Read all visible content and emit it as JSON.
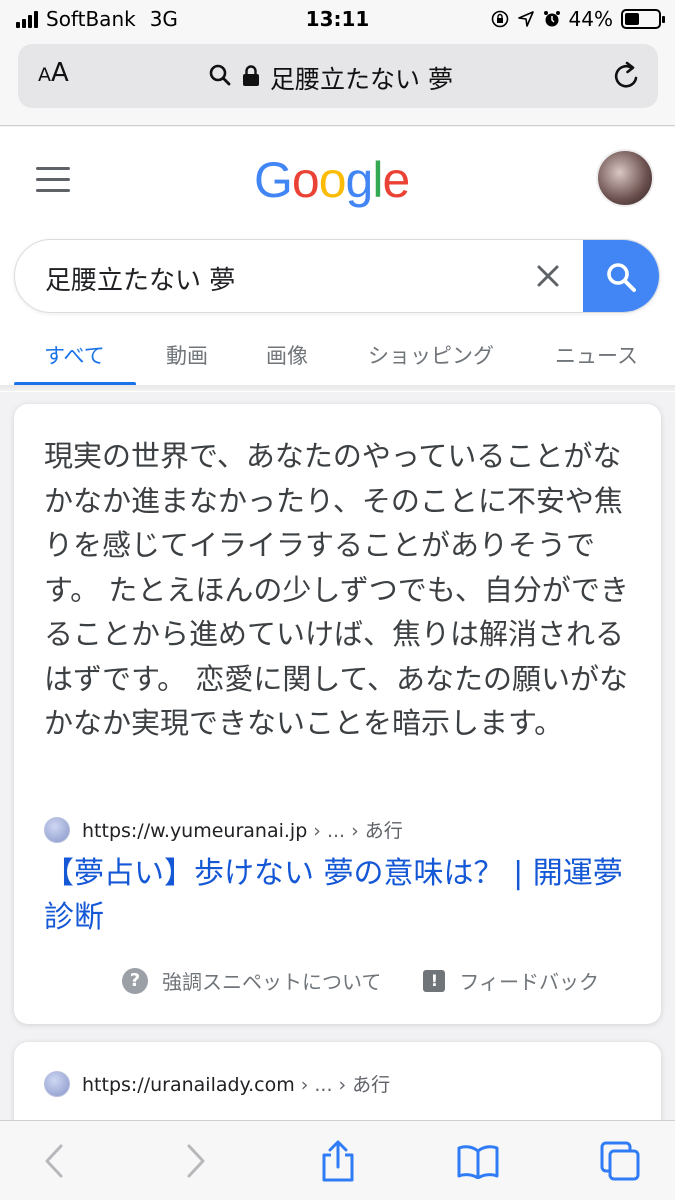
{
  "status_bar": {
    "carrier": "SoftBank",
    "network": "3G",
    "time": "13:11",
    "battery": "44%",
    "battery_level": 0.44
  },
  "safari": {
    "text_size_label": "AA",
    "address": "足腰立たない 夢"
  },
  "google": {
    "logo": "Google",
    "logo_colors": [
      "#4285f4",
      "#ea4335",
      "#fbbc05",
      "#4285f4",
      "#34a853",
      "#ea4335"
    ],
    "search_query": "足腰立たない 夢",
    "tabs": [
      {
        "label": "すべて",
        "active": true
      },
      {
        "label": "動画",
        "active": false
      },
      {
        "label": "画像",
        "active": false
      },
      {
        "label": "ショッピング",
        "active": false
      },
      {
        "label": "ニュース",
        "active": false
      }
    ]
  },
  "featured_snippet": {
    "text": "現実の世界で、あなたのやっていることがなかなか進まなかったり、そのことに不安や焦りを感じてイライラすることがありそうです。 たとえほんの少しずつでも、自分ができることから進めていけば、焦りは解消されるはずです。 恋愛に関して、あなたの願いがなかなか実現できないことを暗示します。",
    "source_url": "https://w.yumeuranai.jp",
    "source_crumbs": " › ... › あ行",
    "title": "【夢占い】歩けない 夢の意味は？ | 開運夢診断",
    "about_label": "強調スニペットについて",
    "feedback_label": "フィードバック"
  },
  "second_result": {
    "source_url": "https://uranailady.com",
    "source_crumbs": " › ... › あ行"
  }
}
